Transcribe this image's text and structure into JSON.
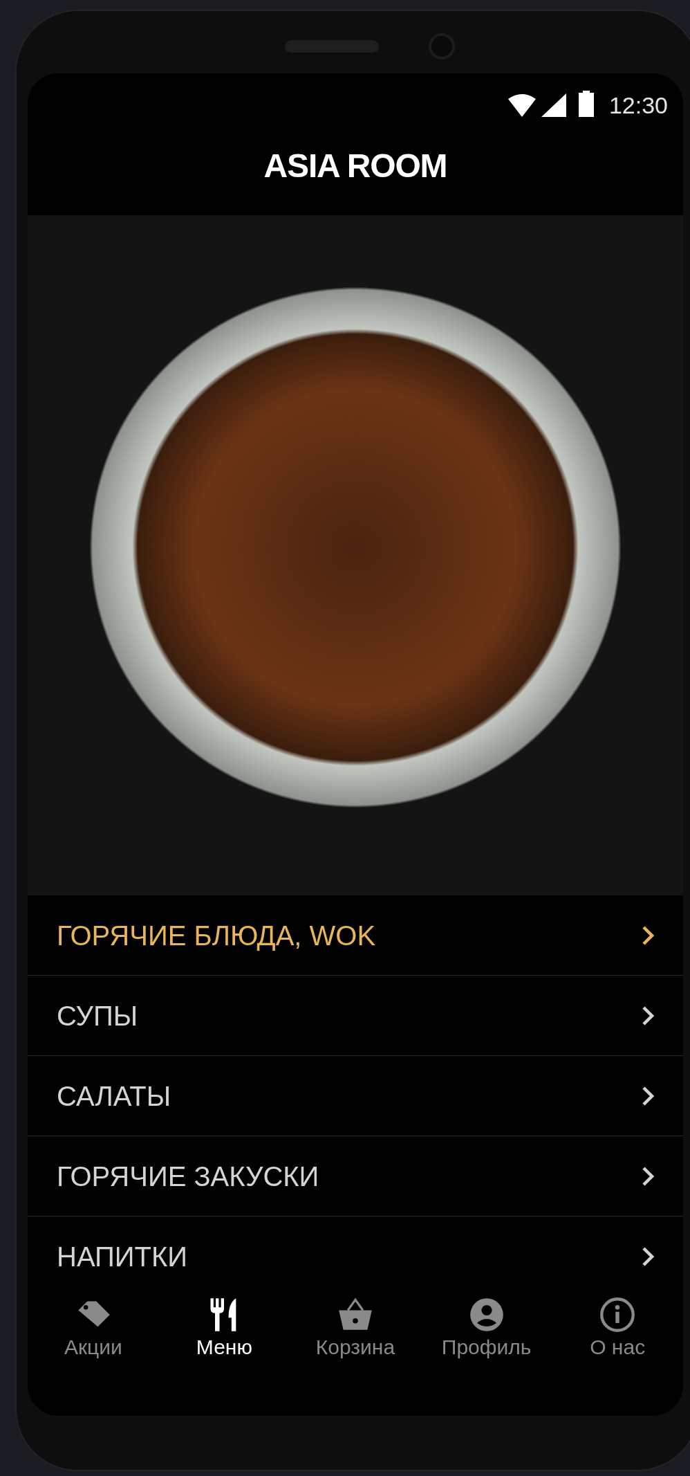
{
  "status_bar": {
    "time": "12:30"
  },
  "app_bar": {
    "title": "ASIA ROOM"
  },
  "menu": [
    {
      "label": "ГОРЯЧИЕ БЛЮДА, WOK",
      "selected": true
    },
    {
      "label": "СУПЫ",
      "selected": false
    },
    {
      "label": "САЛАТЫ",
      "selected": false
    },
    {
      "label": "ГОРЯЧИЕ ЗАКУСКИ",
      "selected": false
    },
    {
      "label": "НАПИТКИ",
      "selected": false
    }
  ],
  "bottom_nav": [
    {
      "label": "Акции",
      "selected": false
    },
    {
      "label": "Меню",
      "selected": true
    },
    {
      "label": "Корзина",
      "selected": false
    },
    {
      "label": "Профиль",
      "selected": false
    },
    {
      "label": "О нас",
      "selected": false
    }
  ]
}
